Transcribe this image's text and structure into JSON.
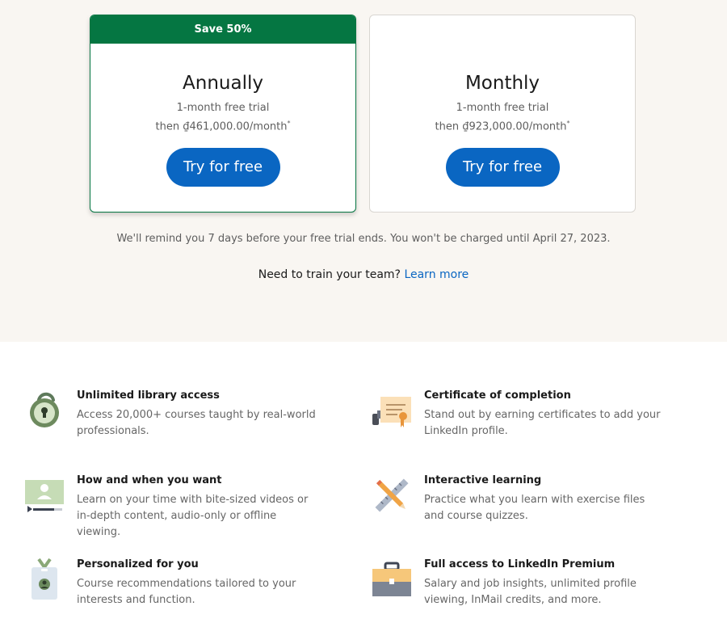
{
  "plans": {
    "annual": {
      "badge": "Save 50%",
      "title": "Annually",
      "trial": "1-month free trial",
      "price": "then ₫461,000.00/month",
      "asterisk": "*",
      "cta": "Try for free"
    },
    "monthly": {
      "title": "Monthly",
      "trial": "1-month free trial",
      "price": "then ₫923,000.00/month",
      "asterisk": "*",
      "cta": "Try for free"
    }
  },
  "reminder": "We'll remind you 7 days before your free trial ends. You won't be charged until April 27, 2023.",
  "train": {
    "text": "Need to train your team?",
    "link": "Learn more"
  },
  "features": [
    {
      "title": "Unlimited library access",
      "desc": "Access 20,000+ courses taught by real-world professionals.",
      "icon": "lock-icon"
    },
    {
      "title": "Certificate of completion",
      "desc": "Stand out by earning certificates to add your LinkedIn profile.",
      "icon": "certificate-icon"
    },
    {
      "title": "How and when you want",
      "desc": "Learn on your time with bite-sized videos or in-depth content, audio-only or offline viewing.",
      "icon": "video-icon"
    },
    {
      "title": "Interactive learning",
      "desc": "Practice what you learn with exercise files and course quizzes.",
      "icon": "tools-icon"
    },
    {
      "title": "Personalized for you",
      "desc": "Course recommendations tailored to your interests and function.",
      "icon": "badge-icon"
    },
    {
      "title": "Full access to LinkedIn Premium",
      "desc": "Salary and job insights, unlimited profile viewing, InMail credits, and more.",
      "icon": "briefcase-icon"
    }
  ],
  "colors": {
    "green": "#057642",
    "blue": "#0a66c2",
    "background": "#f9f6f2"
  }
}
